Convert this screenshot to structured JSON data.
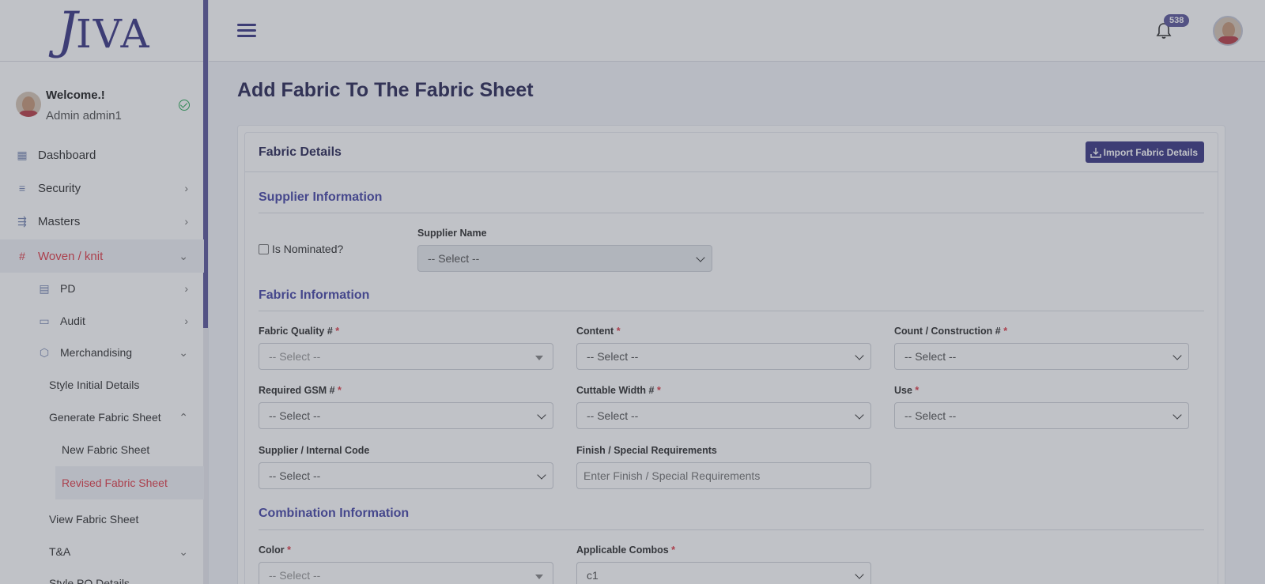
{
  "app": {
    "logo": "JIVA",
    "logo_j": "J",
    "logo_rest": "IVA"
  },
  "topbar": {
    "notification_count": "538"
  },
  "user": {
    "welcome": "Welcome.!",
    "name": "Admin admin1"
  },
  "sidebar": {
    "items": [
      {
        "label": "Dashboard",
        "icon": "grid-icon"
      },
      {
        "label": "Security",
        "icon": "sliders-icon"
      },
      {
        "label": "Masters",
        "icon": "speed-icon"
      },
      {
        "label": "Woven / knit",
        "icon": "hash-icon",
        "active": true
      },
      {
        "label": "PD",
        "icon": "table-icon"
      },
      {
        "label": "Audit",
        "icon": "card-icon"
      },
      {
        "label": "Merchandising",
        "icon": "cube-icon"
      },
      {
        "label": "Style Initial Details"
      },
      {
        "label": "Generate Fabric Sheet"
      },
      {
        "label": "New Fabric Sheet"
      },
      {
        "label": "Revised Fabric Sheet",
        "active": true
      },
      {
        "label": "View Fabric Sheet"
      },
      {
        "label": "T&A"
      },
      {
        "label": "Style PO Details"
      }
    ]
  },
  "page": {
    "title": "Add Fabric To The Fabric Sheet",
    "card_title": "Fabric Details",
    "import_button": "Import Fabric Details"
  },
  "sections": {
    "supplier": "Supplier Information",
    "fabric": "Fabric Information",
    "combination": "Combination Information"
  },
  "fields": {
    "nominated": "Is Nominated?",
    "supplier_name": {
      "label": "Supplier Name",
      "value": "-- Select --"
    },
    "fabric_quality": {
      "label": "Fabric Quality #",
      "value": "-- Select --"
    },
    "content": {
      "label": "Content",
      "value": "-- Select --"
    },
    "count_construction": {
      "label": "Count / Construction #",
      "value": "-- Select --"
    },
    "required_gsm": {
      "label": "Required GSM #",
      "value": "-- Select --"
    },
    "cuttable_width": {
      "label": "Cuttable Width #",
      "value": "-- Select --"
    },
    "use": {
      "label": "Use",
      "value": "-- Select --"
    },
    "supplier_internal_code": {
      "label": "Supplier / Internal Code",
      "value": "-- Select --"
    },
    "finish_special": {
      "label": "Finish / Special Requirements",
      "placeholder": "Enter Finish / Special Requirements"
    },
    "color": {
      "label": "Color",
      "value": "-- Select --"
    },
    "applicable_combos": {
      "label": "Applicable Combos",
      "value": "c1"
    },
    "required_mark": "*"
  },
  "colors": {
    "accent": "#3f3b87",
    "active": "#e0404c",
    "section": "#4b4ba8"
  }
}
